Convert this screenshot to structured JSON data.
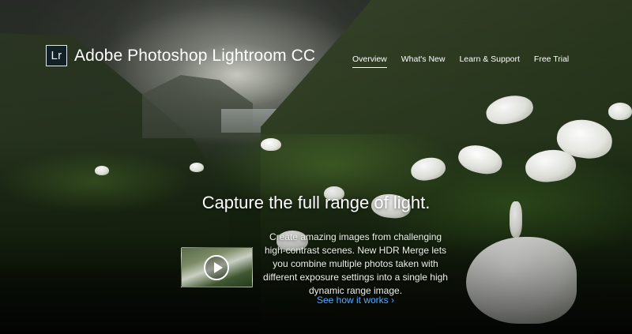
{
  "brand": {
    "logo_text": "Lr",
    "name": "Adobe Photoshop Lightroom CC"
  },
  "nav": {
    "items": [
      {
        "label": "Overview",
        "active": true
      },
      {
        "label": "What's New",
        "active": false
      },
      {
        "label": "Learn & Support",
        "active": false
      },
      {
        "label": "Free Trial",
        "active": false
      }
    ]
  },
  "hero": {
    "headline": "Capture the full range of light.",
    "description": "Create amazing images from challenging high-contrast scenes. New HDR Merge lets you combine multiple photos taken with different exposure settings into a single high dynamic range image.",
    "link_label": "See how it works ›",
    "video_icon": "play-icon"
  },
  "colors": {
    "link": "#56a8ff",
    "text": "#ffffff"
  }
}
